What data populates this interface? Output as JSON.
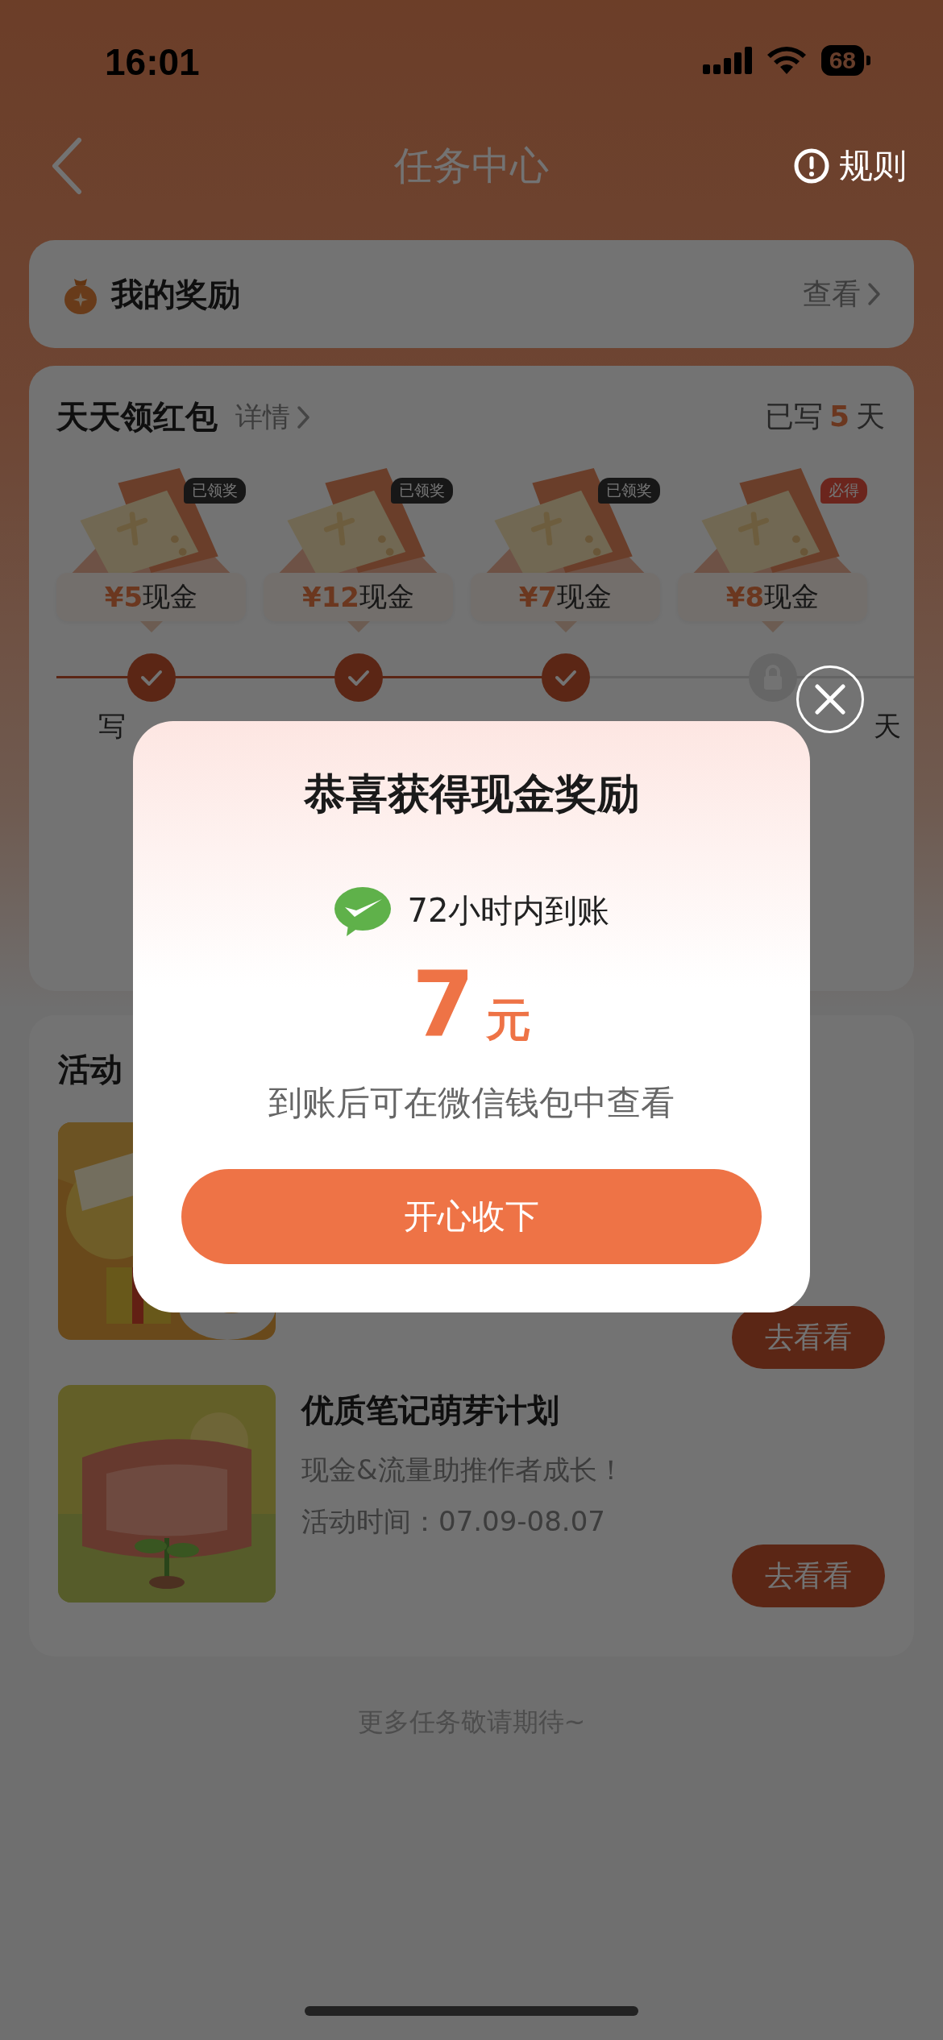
{
  "status_bar": {
    "time": "16:01",
    "battery": "68"
  },
  "nav": {
    "title": "任务中心",
    "rules": "规则"
  },
  "my_rewards": {
    "title": "我的奖励",
    "link": "查看"
  },
  "daily": {
    "title": "天天领红包",
    "details": "详情",
    "streak_prefix": "已写",
    "streak_days": "5",
    "streak_suffix": "天",
    "rewards": [
      {
        "amount": "¥5",
        "unit": "现金",
        "badge": "已领奖",
        "claimed": true,
        "label": "写"
      },
      {
        "amount": "¥12",
        "unit": "现金",
        "badge": "已领奖",
        "claimed": true
      },
      {
        "amount": "¥7",
        "unit": "现金",
        "badge": "已领奖",
        "claimed": true
      },
      {
        "amount": "¥8",
        "unit": "现金",
        "badge": "必得",
        "claimed": false,
        "label": "天"
      }
    ]
  },
  "activities": {
    "title": "活动",
    "items": [
      {
        "kind": "picture",
        "button": "去看看"
      },
      {
        "kind": "entry",
        "title": "优质笔记萌芽计划",
        "description": "现金&流量助推作者成长！",
        "time": "活动时间：07.09-08.07",
        "button": "去看看"
      }
    ]
  },
  "footer": "更多任务敬请期待~",
  "popup": {
    "title": "恭喜获得现金奖励",
    "notice": "72小时内到账",
    "amount": "7",
    "unit": "元",
    "hint": "到账后可在微信钱包中查看",
    "button": "开心收下"
  }
}
